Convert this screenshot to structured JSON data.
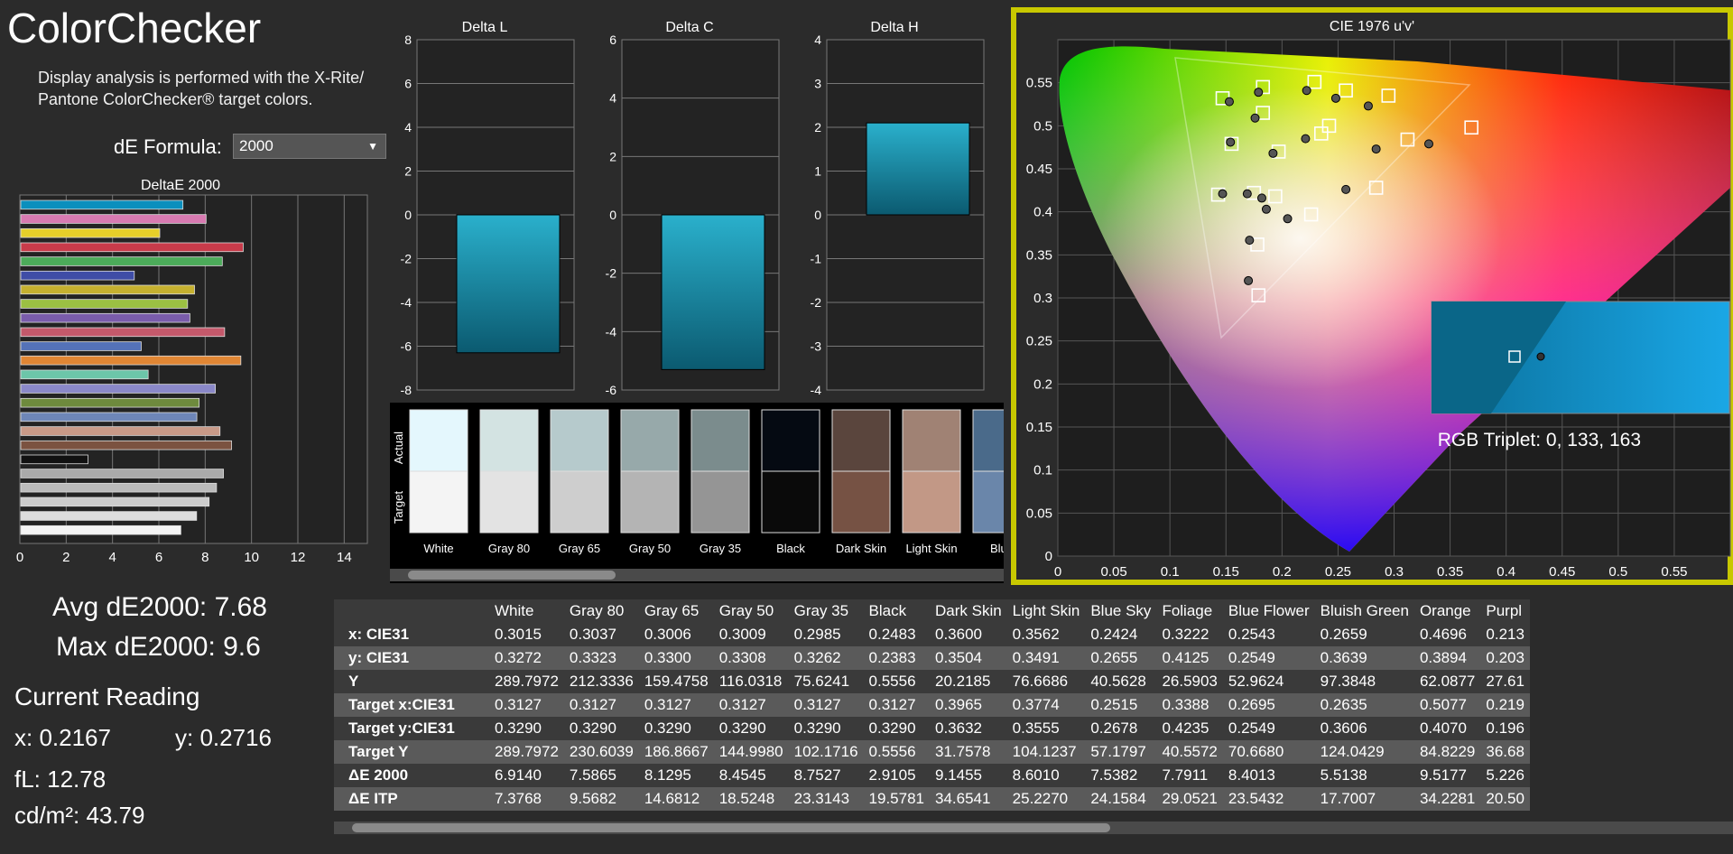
{
  "app": {
    "title": "ColorChecker",
    "description_line1": "Display analysis is performed with the X-Rite/",
    "description_line2": "Pantone ColorChecker® target colors."
  },
  "formula": {
    "label": "dE Formula:",
    "value": "2000"
  },
  "deltaE_chart": {
    "title": "DeltaE 2000",
    "ticks": [
      "0",
      "2",
      "4",
      "6",
      "8",
      "10",
      "12",
      "14"
    ],
    "xmax": 15,
    "bars": [
      {
        "value": 7.0,
        "color": "#0b8fbd"
      },
      {
        "value": 8.0,
        "color": "#d87ab1"
      },
      {
        "value": 6.0,
        "color": "#e6cf2a"
      },
      {
        "value": 9.6,
        "color": "#c83b4a"
      },
      {
        "value": 8.7,
        "color": "#4cab5a"
      },
      {
        "value": 4.9,
        "color": "#3f4da6"
      },
      {
        "value": 7.5,
        "color": "#c5b02f"
      },
      {
        "value": 7.2,
        "color": "#9bc043"
      },
      {
        "value": 7.3,
        "color": "#7a5cab"
      },
      {
        "value": 8.8,
        "color": "#c4596b"
      },
      {
        "value": 5.2,
        "color": "#5472b8"
      },
      {
        "value": 9.5,
        "color": "#e08634"
      },
      {
        "value": 5.5,
        "color": "#6cc6a9"
      },
      {
        "value": 8.4,
        "color": "#8a88c8"
      },
      {
        "value": 7.7,
        "color": "#6e8a3d"
      },
      {
        "value": 7.6,
        "color": "#6e86b8"
      },
      {
        "value": 8.6,
        "color": "#c89a88"
      },
      {
        "value": 9.1,
        "color": "#7b5240"
      },
      {
        "value": 2.9,
        "color": "#111111"
      },
      {
        "value": 8.75,
        "color": "#aaaaaa"
      },
      {
        "value": 8.45,
        "color": "#bbbbbb"
      },
      {
        "value": 8.13,
        "color": "#cccccc"
      },
      {
        "value": 7.59,
        "color": "#dddddd"
      },
      {
        "value": 6.91,
        "color": "#f4f4f4"
      }
    ]
  },
  "delta_l": {
    "title": "Delta L",
    "ticks": [
      "8",
      "6",
      "4",
      "2",
      "0",
      "-2",
      "-4",
      "-6",
      "-8"
    ],
    "min": -8,
    "max": 8,
    "value": -6.3
  },
  "delta_c": {
    "title": "Delta C",
    "ticks": [
      "6",
      "4",
      "2",
      "0",
      "-2",
      "-4",
      "-6"
    ],
    "min": -6,
    "max": 6,
    "value": -5.3
  },
  "delta_h": {
    "title": "Delta H",
    "ticks": [
      "4",
      "3",
      "2",
      "1",
      "0",
      "-1",
      "-2",
      "-3",
      "-4"
    ],
    "min": -4,
    "max": 4,
    "value": 2.1
  },
  "swatches": {
    "actual_label": "Actual",
    "target_label": "Target",
    "items": [
      {
        "label": "White",
        "actual": "#e4f7fd",
        "target": "#f4f4f4"
      },
      {
        "label": "Gray 80",
        "actual": "#d3e3e2",
        "target": "#e3e3e3"
      },
      {
        "label": "Gray 65",
        "actual": "#b6cacc",
        "target": "#cecece"
      },
      {
        "label": "Gray 50",
        "actual": "#97a9aa",
        "target": "#b4b4b4"
      },
      {
        "label": "Gray 35",
        "actual": "#7b8c8d",
        "target": "#959595"
      },
      {
        "label": "Black",
        "actual": "#050a12",
        "target": "#0a0a0a"
      },
      {
        "label": "Dark Skin",
        "actual": "#5a453d",
        "target": "#765244"
      },
      {
        "label": "Light Skin",
        "actual": "#a08274",
        "target": "#c29886"
      },
      {
        "label": "Blue",
        "actual": "#4a6a8a",
        "target": "#6a86aa"
      }
    ]
  },
  "stats": {
    "avg": "Avg dE2000: 7.68",
    "max": "Max dE2000: 9.6",
    "reading_title": "Current Reading",
    "x": "x: 0.2167",
    "y": "y: 0.2716",
    "fl": "fL: 12.78",
    "cdm2": "cd/m²: 43.79"
  },
  "cie": {
    "title": "CIE 1976 u'v'",
    "rgb_triplet": "RGB Triplet: 0, 133, 163",
    "xticks": [
      "0",
      "0.05",
      "0.1",
      "0.15",
      "0.2",
      "0.25",
      "0.3",
      "0.35",
      "0.4",
      "0.45",
      "0.5",
      "0.55"
    ],
    "yticks": [
      "0.55",
      "0.5",
      "0.45",
      "0.4",
      "0.35",
      "0.3",
      "0.25",
      "0.2",
      "0.15",
      "0.1",
      "0.05",
      "0"
    ],
    "targets": [
      [
        0.147,
        0.532
      ],
      [
        0.183,
        0.545
      ],
      [
        0.229,
        0.551
      ],
      [
        0.257,
        0.541
      ],
      [
        0.295,
        0.535
      ],
      [
        0.183,
        0.515
      ],
      [
        0.242,
        0.5
      ],
      [
        0.235,
        0.491
      ],
      [
        0.155,
        0.479
      ],
      [
        0.312,
        0.484
      ],
      [
        0.369,
        0.498
      ],
      [
        0.197,
        0.47
      ],
      [
        0.143,
        0.42
      ],
      [
        0.175,
        0.422
      ],
      [
        0.194,
        0.418
      ],
      [
        0.284,
        0.428
      ],
      [
        0.226,
        0.397
      ],
      [
        0.178,
        0.362
      ],
      [
        0.179,
        0.303
      ]
    ],
    "measured": [
      [
        0.153,
        0.528
      ],
      [
        0.179,
        0.539
      ],
      [
        0.222,
        0.541
      ],
      [
        0.248,
        0.532
      ],
      [
        0.277,
        0.523
      ],
      [
        0.176,
        0.509
      ],
      [
        0.221,
        0.485
      ],
      [
        0.154,
        0.481
      ],
      [
        0.284,
        0.473
      ],
      [
        0.331,
        0.479
      ],
      [
        0.192,
        0.468
      ],
      [
        0.147,
        0.421
      ],
      [
        0.169,
        0.421
      ],
      [
        0.182,
        0.416
      ],
      [
        0.257,
        0.426
      ],
      [
        0.205,
        0.392
      ],
      [
        0.171,
        0.367
      ],
      [
        0.17,
        0.32
      ],
      [
        0.186,
        0.403
      ]
    ]
  },
  "table": {
    "columns": [
      "White",
      "Gray 80",
      "Gray 65",
      "Gray 50",
      "Gray 35",
      "Black",
      "Dark Skin",
      "Light Skin",
      "Blue Sky",
      "Foliage",
      "Blue Flower",
      "Bluish Green",
      "Orange",
      "Purpl"
    ],
    "rows": [
      {
        "label": "x: CIE31",
        "cells": [
          "0.3015",
          "0.3037",
          "0.3006",
          "0.3009",
          "0.2985",
          "0.2483",
          "0.3600",
          "0.3562",
          "0.2424",
          "0.3222",
          "0.2543",
          "0.2659",
          "0.4696",
          "0.213"
        ]
      },
      {
        "label": "y: CIE31",
        "cells": [
          "0.3272",
          "0.3323",
          "0.3300",
          "0.3308",
          "0.3262",
          "0.2383",
          "0.3504",
          "0.3491",
          "0.2655",
          "0.4125",
          "0.2549",
          "0.3639",
          "0.3894",
          "0.203"
        ]
      },
      {
        "label": "Y",
        "cells": [
          "289.7972",
          "212.3336",
          "159.4758",
          "116.0318",
          "75.6241",
          "0.5556",
          "20.2185",
          "76.6686",
          "40.5628",
          "26.5903",
          "52.9624",
          "97.3848",
          "62.0877",
          "27.61"
        ]
      },
      {
        "label": "Target x:CIE31",
        "cells": [
          "0.3127",
          "0.3127",
          "0.3127",
          "0.3127",
          "0.3127",
          "0.3127",
          "0.3965",
          "0.3774",
          "0.2515",
          "0.3388",
          "0.2695",
          "0.2635",
          "0.5077",
          "0.219"
        ]
      },
      {
        "label": "Target y:CIE31",
        "cells": [
          "0.3290",
          "0.3290",
          "0.3290",
          "0.3290",
          "0.3290",
          "0.3290",
          "0.3632",
          "0.3555",
          "0.2678",
          "0.4235",
          "0.2549",
          "0.3606",
          "0.4070",
          "0.196"
        ]
      },
      {
        "label": "Target Y",
        "cells": [
          "289.7972",
          "230.6039",
          "186.8667",
          "144.9980",
          "102.1716",
          "0.5556",
          "31.7578",
          "104.1237",
          "57.1797",
          "40.5572",
          "70.6680",
          "124.0429",
          "84.8229",
          "36.68"
        ]
      },
      {
        "label": "ΔE 2000",
        "cells": [
          "6.9140",
          "7.5865",
          "8.1295",
          "8.4545",
          "8.7527",
          "2.9105",
          "9.1455",
          "8.6010",
          "7.5382",
          "7.7911",
          "8.4013",
          "5.5138",
          "9.5177",
          "5.226"
        ]
      },
      {
        "label": "ΔE ITP",
        "cells": [
          "7.3768",
          "9.5682",
          "14.6812",
          "18.5248",
          "23.3143",
          "19.5781",
          "34.6541",
          "25.2270",
          "24.1584",
          "29.0521",
          "23.5432",
          "17.7007",
          "34.2281",
          "20.50"
        ]
      }
    ]
  }
}
